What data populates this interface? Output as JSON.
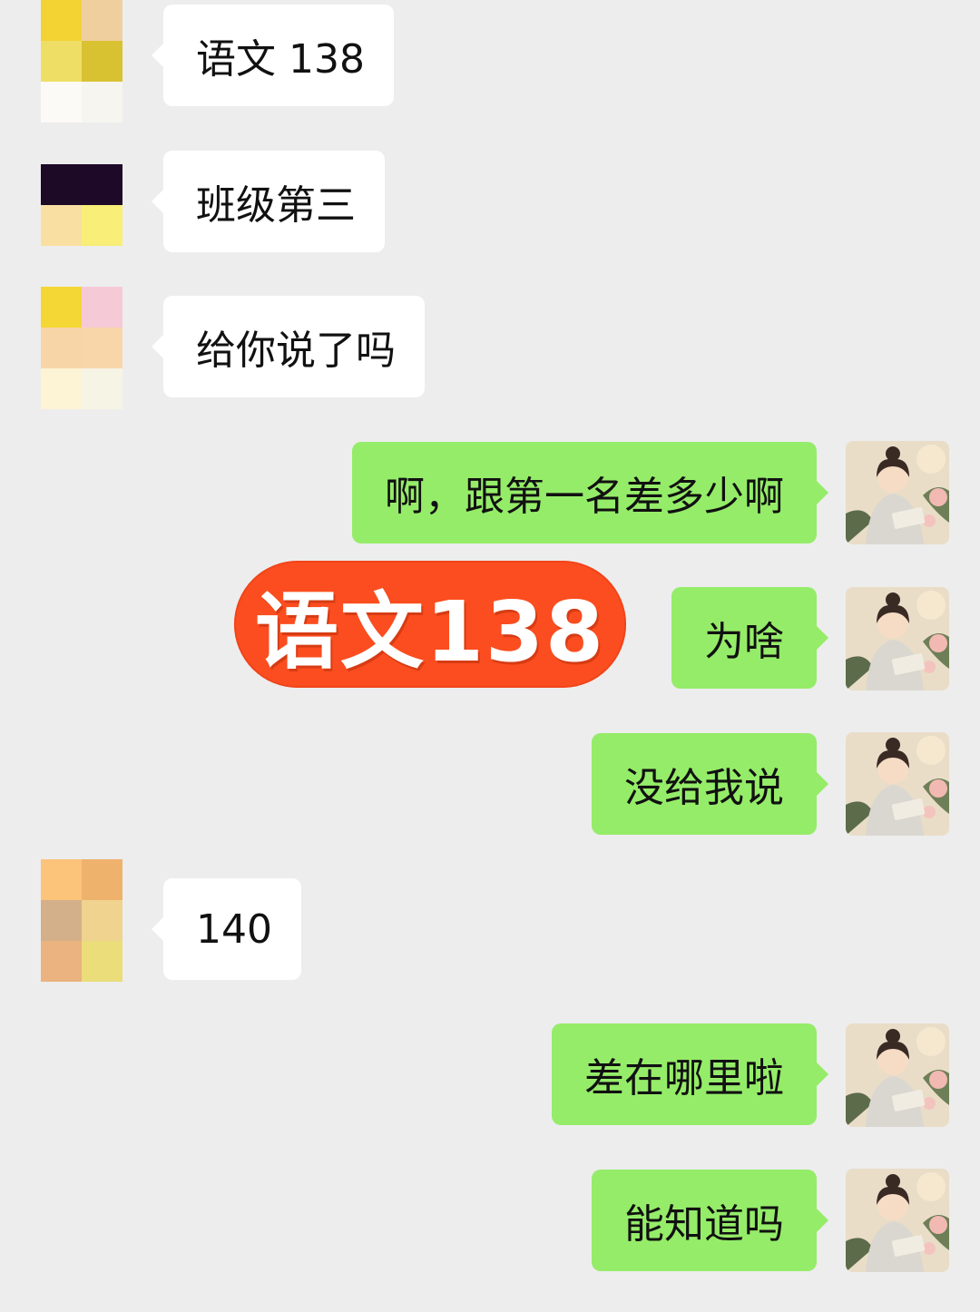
{
  "colors": {
    "background": "#ededed",
    "incoming_bubble": "#ffffff",
    "outgoing_bubble": "#95ec69",
    "sticker": "#fb4d1f"
  },
  "messages": [
    {
      "side": "incoming",
      "text": "语文 138"
    },
    {
      "side": "incoming",
      "text": "班级第三"
    },
    {
      "side": "incoming",
      "text": "给你说了吗"
    },
    {
      "side": "outgoing",
      "text": "啊，跟第一名差多少啊"
    },
    {
      "side": "outgoing",
      "text": "为啥"
    },
    {
      "side": "outgoing",
      "text": "没给我说"
    },
    {
      "side": "incoming",
      "text": "140"
    },
    {
      "side": "outgoing",
      "text": "差在哪里啦"
    },
    {
      "side": "outgoing",
      "text": "能知道吗"
    }
  ],
  "sticker": {
    "text": "语文138"
  },
  "avatars": {
    "incoming": "pixelated-avatar",
    "outgoing": "illustrated-girl-reading-avatar"
  }
}
